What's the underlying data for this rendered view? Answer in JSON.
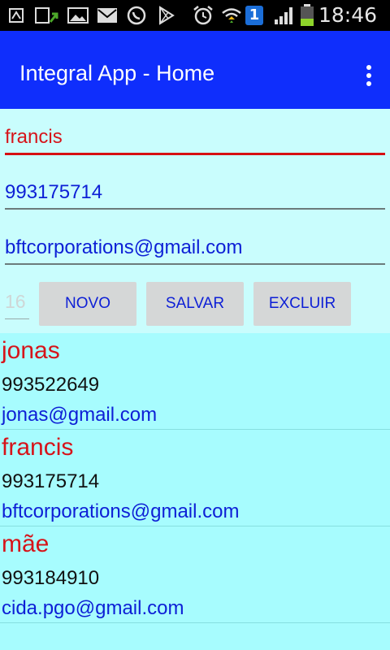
{
  "status_bar": {
    "time": "18:46",
    "icons": [
      "sync-icon",
      "download-icon",
      "image-icon",
      "mail-icon",
      "whatsapp-icon",
      "play-store-icon",
      "alarm-icon",
      "wifi-icon",
      "sim-badge-icon",
      "signal-icon",
      "battery-icon"
    ],
    "sim_badge": "1"
  },
  "app_bar": {
    "title": "Integral App - Home",
    "overflow_icon": "more-vert-icon"
  },
  "form": {
    "name_value": "francis",
    "phone_value": "993175714",
    "email_value": "bftcorporations@gmail.com",
    "id_value": "16",
    "buttons": {
      "new_label": "NOVO",
      "save_label": "SALVAR",
      "delete_label": "EXCLUIR"
    }
  },
  "contacts": [
    {
      "name": "jonas",
      "phone": "993522649",
      "email": "jonas@gmail.com"
    },
    {
      "name": "francis",
      "phone": "993175714",
      "email": "bftcorporations@gmail.com"
    },
    {
      "name": "mãe",
      "phone": "993184910",
      "email": "cida.pgo@gmail.com"
    }
  ],
  "colors": {
    "app_bar": "#0f2efc",
    "background": "#c9fdfd",
    "list_background": "#a7fcfe",
    "name_text": "#d6141a",
    "link_text": "#0d1fd6",
    "button": "#d5d7d7"
  }
}
